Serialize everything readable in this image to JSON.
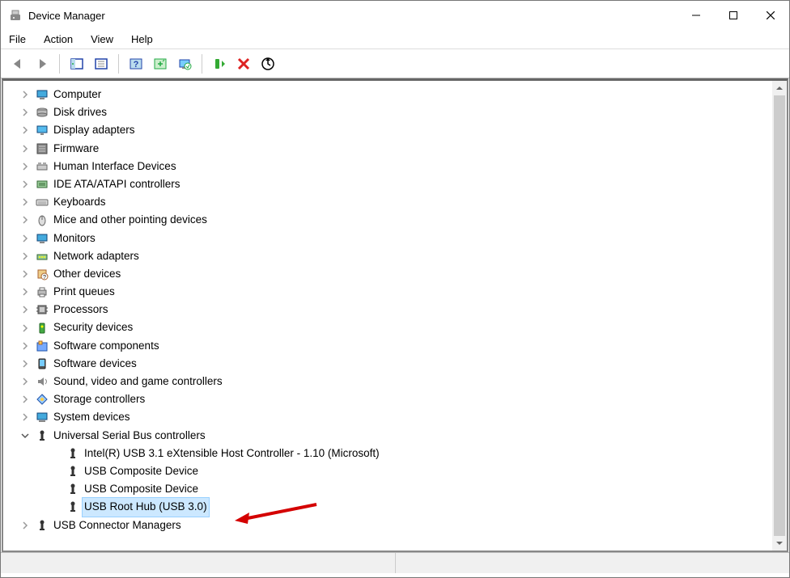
{
  "window": {
    "title": "Device Manager"
  },
  "menu": {
    "file": "File",
    "action": "Action",
    "view": "View",
    "help": "Help"
  },
  "tree": {
    "categories": [
      {
        "label": "Computer",
        "icon": "computer"
      },
      {
        "label": "Disk drives",
        "icon": "disk"
      },
      {
        "label": "Display adapters",
        "icon": "display"
      },
      {
        "label": "Firmware",
        "icon": "firmware"
      },
      {
        "label": "Human Interface Devices",
        "icon": "hid"
      },
      {
        "label": "IDE ATA/ATAPI controllers",
        "icon": "ide"
      },
      {
        "label": "Keyboards",
        "icon": "keyboard"
      },
      {
        "label": "Mice and other pointing devices",
        "icon": "mouse"
      },
      {
        "label": "Monitors",
        "icon": "monitor"
      },
      {
        "label": "Network adapters",
        "icon": "network"
      },
      {
        "label": "Other devices",
        "icon": "other"
      },
      {
        "label": "Print queues",
        "icon": "printer"
      },
      {
        "label": "Processors",
        "icon": "cpu"
      },
      {
        "label": "Security devices",
        "icon": "security"
      },
      {
        "label": "Software components",
        "icon": "swcomp"
      },
      {
        "label": "Software devices",
        "icon": "swdev"
      },
      {
        "label": "Sound, video and game controllers",
        "icon": "sound"
      },
      {
        "label": "Storage controllers",
        "icon": "storage"
      },
      {
        "label": "System devices",
        "icon": "system"
      }
    ],
    "usb_category": {
      "label": "Universal Serial Bus controllers",
      "children": [
        {
          "label": "Intel(R) USB 3.1 eXtensible Host Controller - 1.10 (Microsoft)",
          "selected": false
        },
        {
          "label": "USB Composite Device",
          "selected": false
        },
        {
          "label": "USB Composite Device",
          "selected": false
        },
        {
          "label": "USB Root Hub (USB 3.0)",
          "selected": true
        }
      ]
    },
    "usb_connector": {
      "label": "USB Connector Managers"
    }
  }
}
